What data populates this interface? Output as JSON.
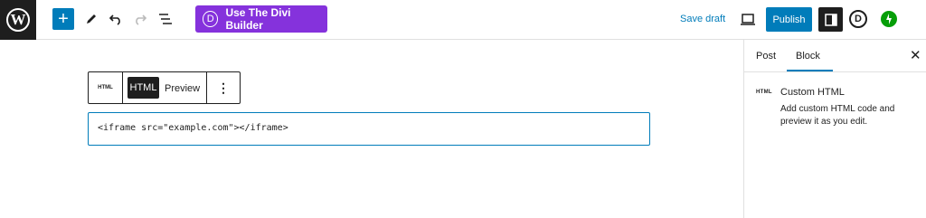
{
  "toolbar": {
    "add_label": "+",
    "divi_button": "Use The Divi Builder",
    "divi_letter": "D",
    "save_draft": "Save draft",
    "publish": "Publish"
  },
  "block_toolbar": {
    "type_icon_label": "HTML",
    "html_tab": "HTML",
    "preview_tab": "Preview",
    "more_label": "⋮"
  },
  "editor": {
    "code": "<iframe src=\"example.com\"></iframe>"
  },
  "sidebar": {
    "tabs": [
      "Post",
      "Block"
    ],
    "active_tab": "Block",
    "close_label": "✕",
    "block_icon_label": "HTML",
    "block_title": "Custom HTML",
    "block_description": "Add custom HTML code and preview it as you edit."
  },
  "colors": {
    "accent": "#007cba",
    "divi_purple": "#8532dc",
    "dark": "#1e1e1e",
    "jetpack_green": "#069e08"
  }
}
